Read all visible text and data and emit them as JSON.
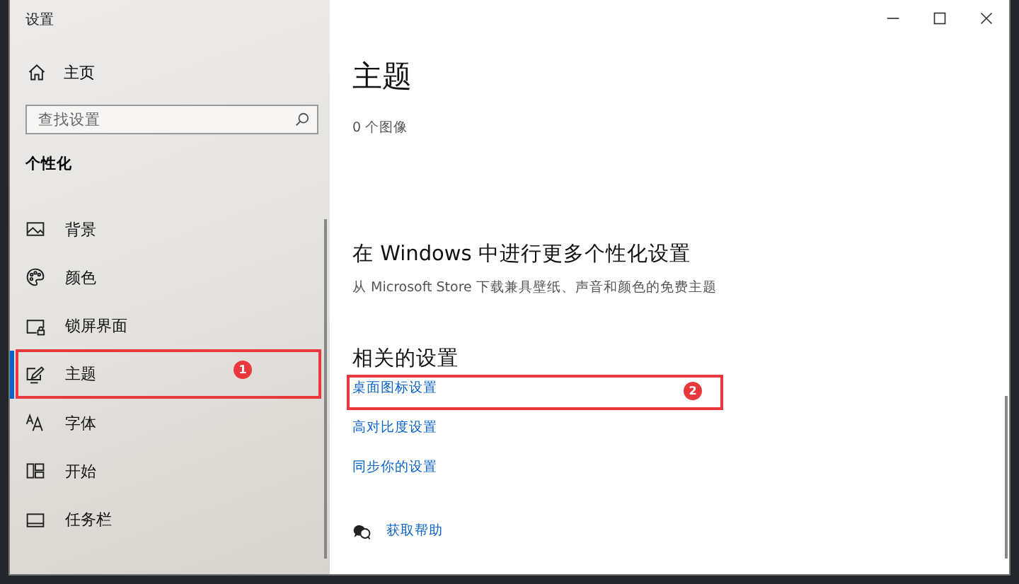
{
  "window": {
    "title": "设置"
  },
  "sidebar": {
    "home": {
      "label": "主页"
    },
    "search": {
      "placeholder": "查找设置"
    },
    "section": "个性化",
    "items": [
      {
        "label": "背景",
        "selected": false
      },
      {
        "label": "颜色",
        "selected": false
      },
      {
        "label": "锁屏界面",
        "selected": false
      },
      {
        "label": "主题",
        "selected": true,
        "annotation": "1"
      },
      {
        "label": "字体",
        "selected": false
      },
      {
        "label": "开始",
        "selected": false
      },
      {
        "label": "任务栏",
        "selected": false
      }
    ]
  },
  "content": {
    "title": "主题",
    "caption": "0 个图像",
    "more": {
      "heading": "在 Windows 中进行更多个性化设置",
      "text": "从 Microsoft Store 下载兼具壁纸、声音和颜色的免费主题"
    },
    "related": {
      "heading": "相关的设置",
      "links": [
        {
          "label": "桌面图标设置",
          "annotation": "2"
        },
        {
          "label": "高对比度设置"
        },
        {
          "label": "同步你的设置"
        }
      ]
    },
    "help": {
      "label": "获取帮助"
    }
  }
}
